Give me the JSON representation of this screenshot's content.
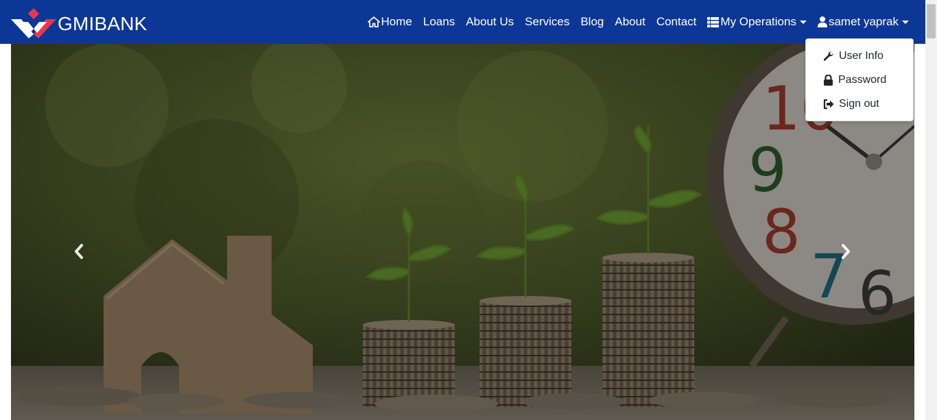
{
  "brand": {
    "name": "GMIBANK"
  },
  "nav": {
    "items": [
      {
        "label": "Home",
        "icon": "home-icon"
      },
      {
        "label": "Loans"
      },
      {
        "label": "About Us"
      },
      {
        "label": "Services"
      },
      {
        "label": "Blog"
      },
      {
        "label": "About"
      },
      {
        "label": "Contact"
      },
      {
        "label": "My Operations",
        "icon": "th-list-icon",
        "dropdown": true
      },
      {
        "label": "samet yaprak",
        "icon": "user-icon",
        "dropdown": true
      }
    ]
  },
  "account_menu": {
    "items": [
      {
        "label": "User Info",
        "icon": "wrench-icon"
      },
      {
        "label": "Password",
        "icon": "lock-icon"
      },
      {
        "label": "Sign out",
        "icon": "sign-out-icon"
      }
    ]
  },
  "carousel": {
    "prev_icon": "chevron-left-icon",
    "next_icon": "chevron-right-icon"
  },
  "colors": {
    "navbar": "#0d3796",
    "logo_red": "#e8384f",
    "white": "#ffffff"
  }
}
